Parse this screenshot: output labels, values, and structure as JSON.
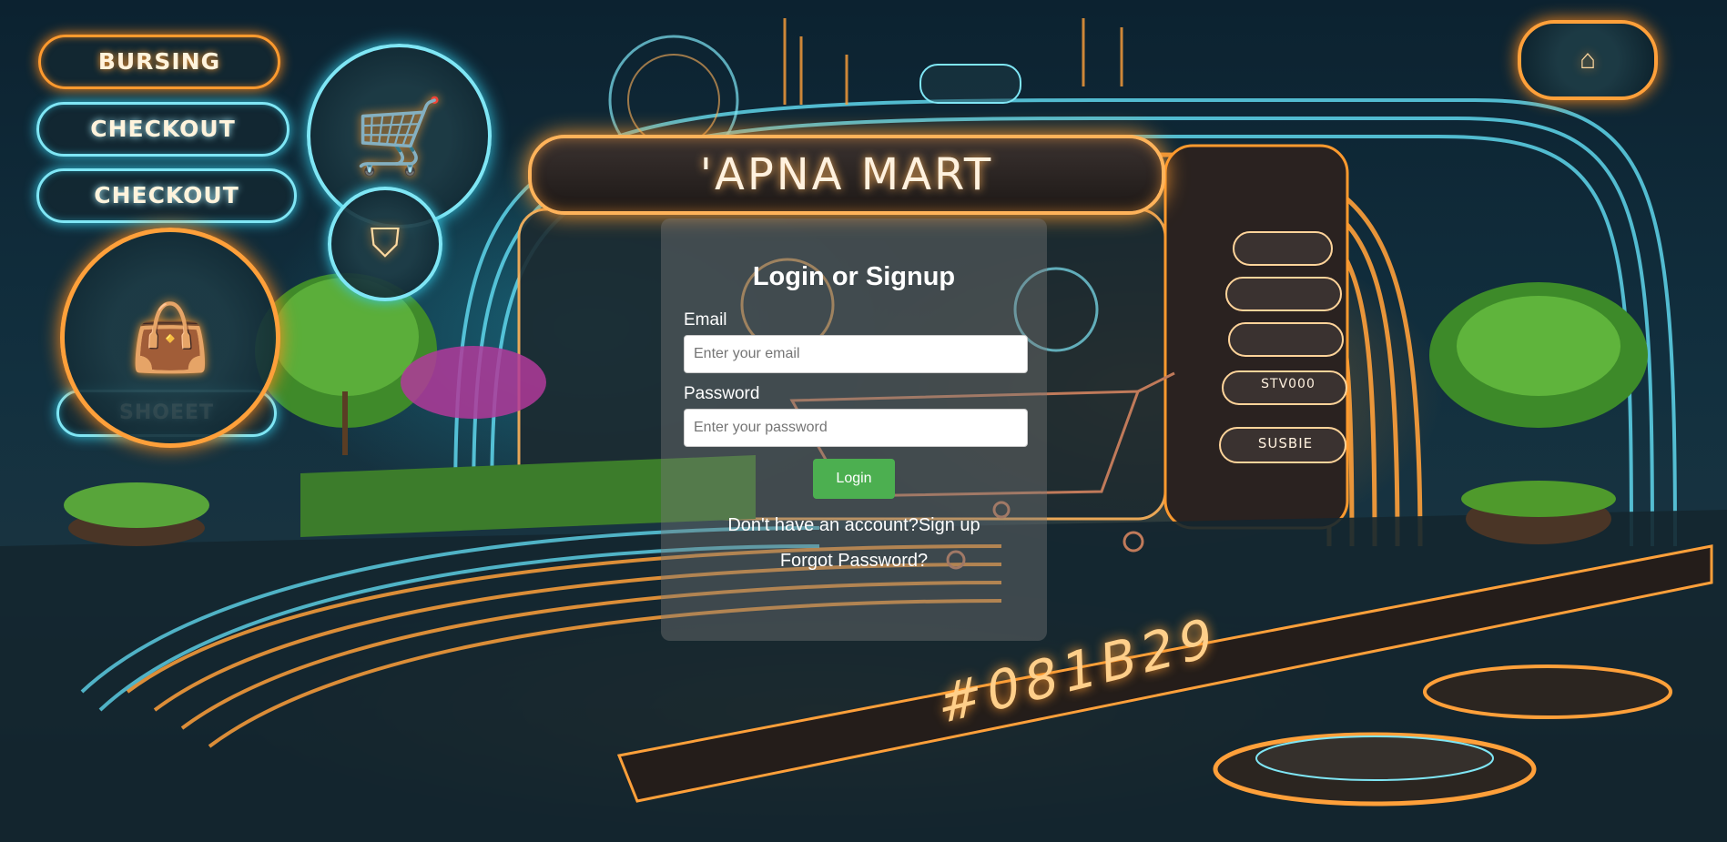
{
  "background": {
    "store_sign": "'APNA MART",
    "floor_code": "#081B29",
    "neon_labels": [
      "BURSING",
      "CHECKOUT",
      "CHECKOUT",
      "SHOEET"
    ],
    "kiosk_labels": [
      "STV000",
      "SUSBIE"
    ],
    "colors": {
      "neon_orange": "#ff9a2e",
      "neon_cyan": "#34c7e3",
      "dark_bg": "#0c2230"
    },
    "icons": [
      "shopping-cart-icon",
      "shopping-bag-icon",
      "home-icon",
      "target-icon",
      "shield-icon"
    ]
  },
  "login": {
    "title": "Login or Signup",
    "email_label": "Email",
    "email_placeholder": "Enter your email",
    "email_value": "",
    "password_label": "Password",
    "password_placeholder": "Enter your password",
    "password_value": "",
    "login_button": "Login",
    "signup_prompt": "Don't have an account?",
    "signup_link": "Sign up",
    "forgot_password": "Forgot Password?",
    "colors": {
      "button": "#4caf50",
      "card_overlay": "rgba(120,120,120,0.42)"
    }
  }
}
